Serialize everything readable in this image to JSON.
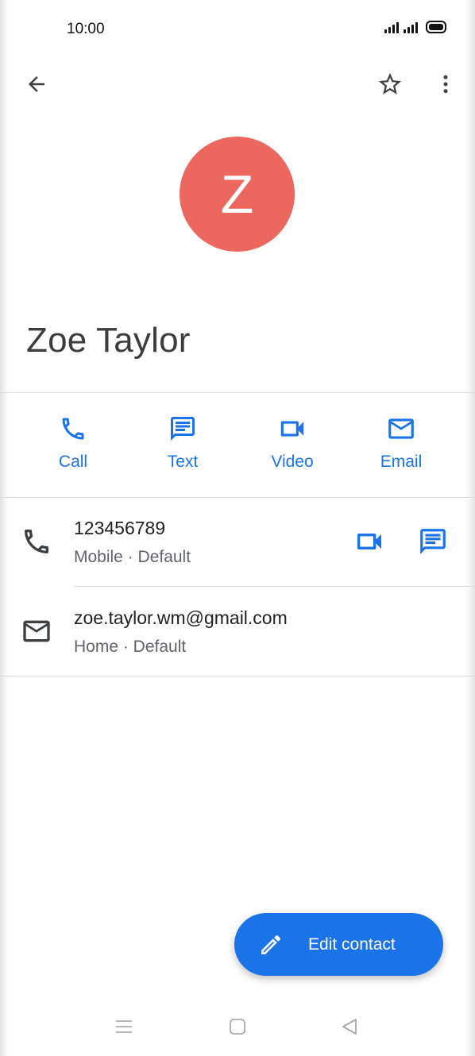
{
  "status_bar": {
    "time": "10:00"
  },
  "contact": {
    "initial": "Z",
    "name": "Zoe Taylor",
    "avatar_color": "#ec685e"
  },
  "actions": [
    {
      "label": "Call",
      "icon": "phone-icon"
    },
    {
      "label": "Text",
      "icon": "message-icon"
    },
    {
      "label": "Video",
      "icon": "video-icon"
    },
    {
      "label": "Email",
      "icon": "email-icon"
    }
  ],
  "details": {
    "phone": {
      "value": "123456789",
      "type": "Mobile · Default"
    },
    "email": {
      "value": "zoe.taylor.wm@gmail.com",
      "type": "Home · Default"
    }
  },
  "fab": {
    "label": "Edit contact",
    "icon": "pencil-icon"
  },
  "colors": {
    "accent": "#1a73e8",
    "text_primary": "#202124",
    "text_secondary": "#5f6368"
  },
  "nav": {
    "items": [
      "menu-icon",
      "home-icon",
      "back-triangle-icon"
    ]
  }
}
